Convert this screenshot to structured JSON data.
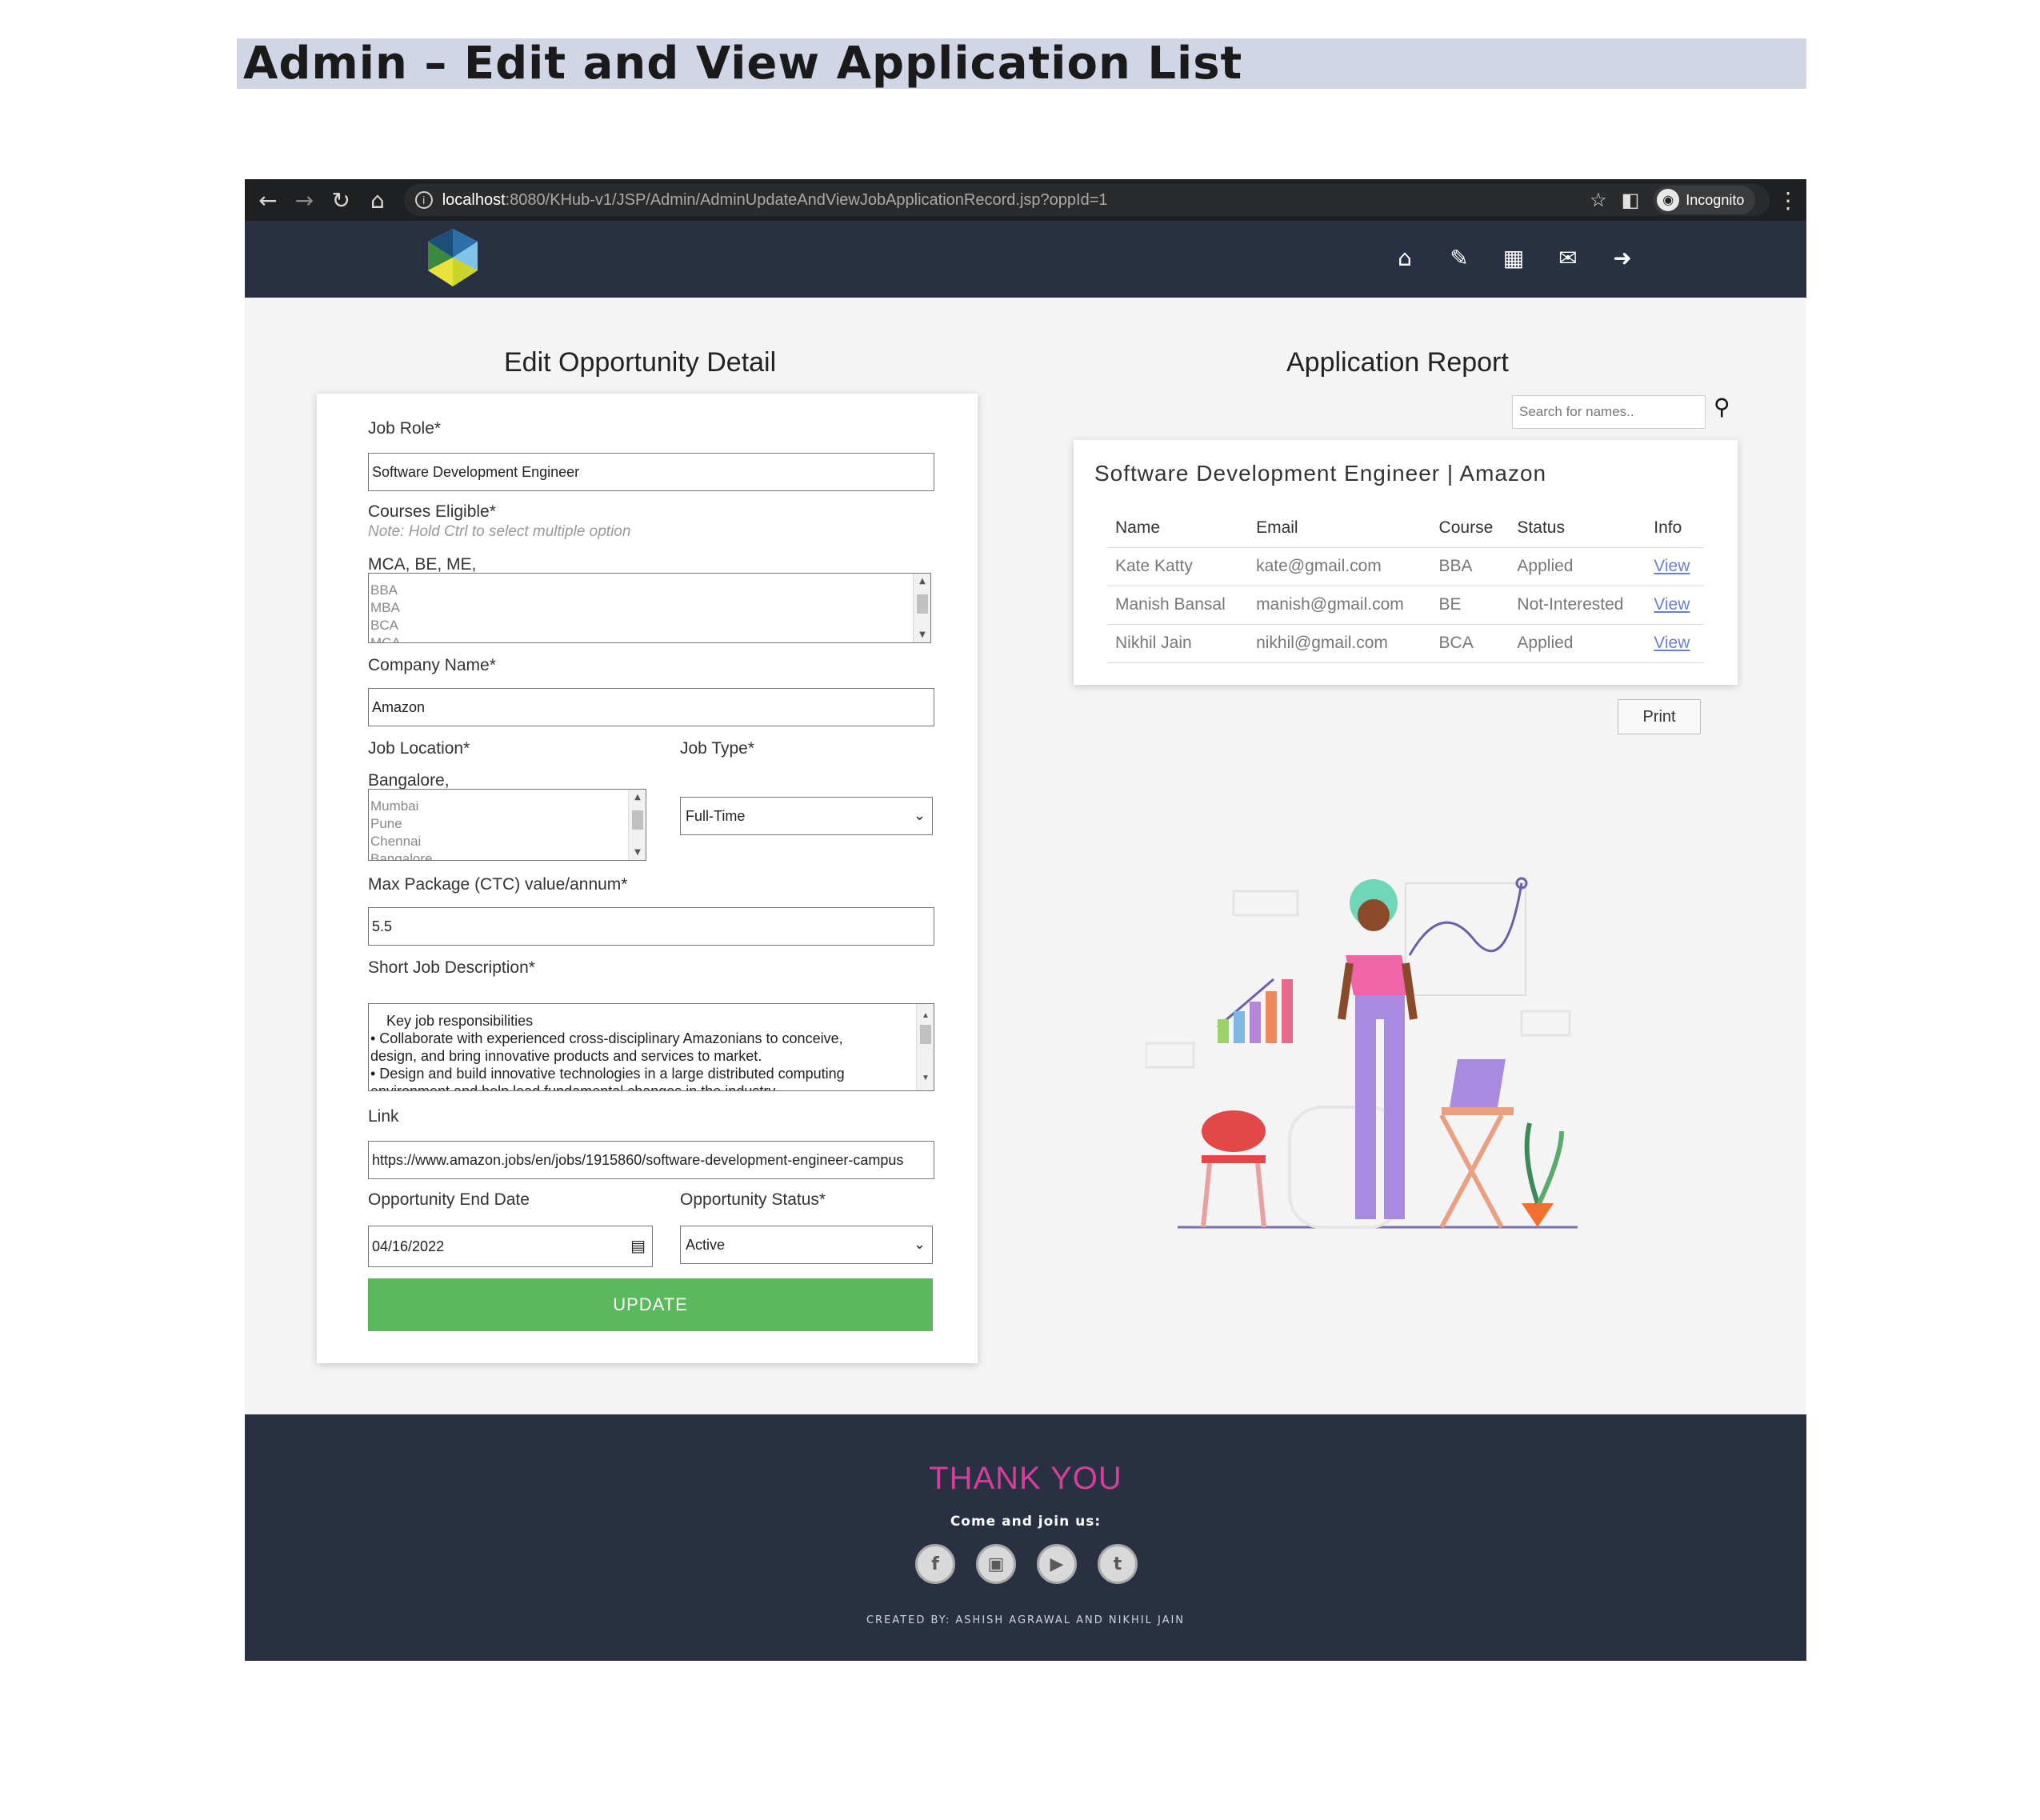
{
  "doc_title": "Admin – Edit and View Application List",
  "browser": {
    "url_host": "localhost",
    "url_path": ":8080/KHub-v1/JSP/Admin/AdminUpdateAndViewJobApplicationRecord.jsp?oppId=1",
    "incognito_label": "Incognito"
  },
  "edit_section": {
    "title": "Edit Opportunity Detail",
    "job_role_label": "Job Role*",
    "job_role_value": "Software Development Engineer",
    "courses_label": "Courses Eligible*",
    "courses_note": "Note: Hold Ctrl to select multiple option",
    "courses_selected": "MCA, BE, ME,",
    "course_options": [
      "BBA",
      "MBA",
      "BCA",
      "MCA"
    ],
    "company_label": "Company Name*",
    "company_value": "Amazon",
    "location_label": "Job Location*",
    "location_selected": "Bangalore,",
    "location_options": [
      "Mumbai",
      "Pune",
      "Chennai",
      "Bangalore"
    ],
    "job_type_label": "Job Type*",
    "job_type_value": "Full-Time",
    "package_label": "Max Package (CTC) value/annum*",
    "package_value": "5.5",
    "description_label": "Short Job Description*",
    "description_lines": [
      "    Key job responsibilities",
      "• Collaborate with experienced cross-disciplinary Amazonians to conceive,",
      "design, and bring innovative products and services to market.",
      "• Design and build innovative technologies in a large distributed computing",
      "environment and help lead fundamental changes in the industry."
    ],
    "link_label": "Link",
    "link_value": "https://www.amazon.jobs/en/jobs/1915860/software-development-engineer-campus",
    "end_date_label": "Opportunity End Date",
    "end_date_value": "04/16/2022",
    "status_label": "Opportunity Status*",
    "status_value": "Active",
    "update_label": "UPDATE"
  },
  "report_section": {
    "title": "Application Report",
    "search_placeholder": "Search for names..",
    "card_title": "Software Development Engineer | Amazon",
    "columns": [
      "Name",
      "Email",
      "Course",
      "Status",
      "Info"
    ],
    "rows": [
      {
        "name": "Kate Katty",
        "email": "kate@gmail.com",
        "course": "BBA",
        "status": "Applied",
        "info": "View"
      },
      {
        "name": "Manish Bansal",
        "email": "manish@gmail.com",
        "course": "BE",
        "status": "Not-Interested",
        "info": "View"
      },
      {
        "name": "Nikhil Jain",
        "email": "nikhil@gmail.com",
        "course": "BCA",
        "status": "Applied",
        "info": "View"
      }
    ],
    "print_label": "Print"
  },
  "footer": {
    "thanks": "THANK YOU",
    "join": "Come and join us:",
    "social_icons": [
      "facebook-icon",
      "instagram-icon",
      "youtube-icon",
      "twitter-icon"
    ],
    "credit": "CREATED BY: ASHISH AGRAWAL AND NIKHIL JAIN"
  },
  "colors": {
    "nav_bg": "#283041",
    "update_green": "#5cb85c",
    "thanks_pink": "#d2409a",
    "title_band": "#d1d6e6"
  }
}
